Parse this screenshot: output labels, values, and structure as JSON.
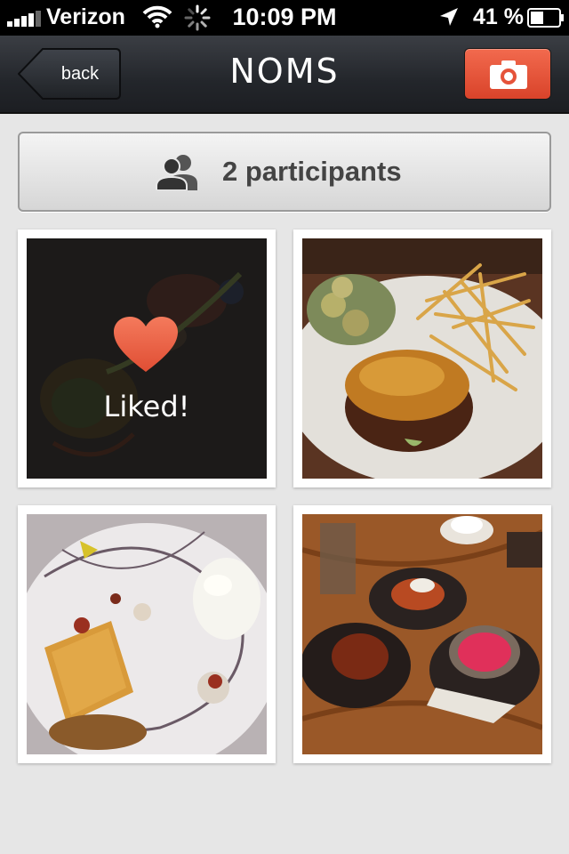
{
  "status_bar": {
    "carrier": "Verizon",
    "time": "10:09 PM",
    "battery_percent": "41 %",
    "icons": [
      "signal-icon",
      "wifi-icon",
      "activity-spinner-icon",
      "location-arrow-icon",
      "battery-icon"
    ]
  },
  "nav": {
    "back_label": "back",
    "title": "NOMS",
    "camera_icon": "camera-icon"
  },
  "participants": {
    "label": "2 participants",
    "icon": "people-icon"
  },
  "photos": [
    {
      "subject": "plated entrée",
      "liked": true,
      "liked_label": "Liked!"
    },
    {
      "subject": "burger and fries",
      "liked": false
    },
    {
      "subject": "plated dessert",
      "liked": false
    },
    {
      "subject": "desserts on wooden table",
      "liked": false
    }
  ],
  "colors": {
    "accent": "#e5533a",
    "nav_bar": "#2a2d32",
    "background": "#e6e6e6",
    "heart": "#f0634a"
  }
}
